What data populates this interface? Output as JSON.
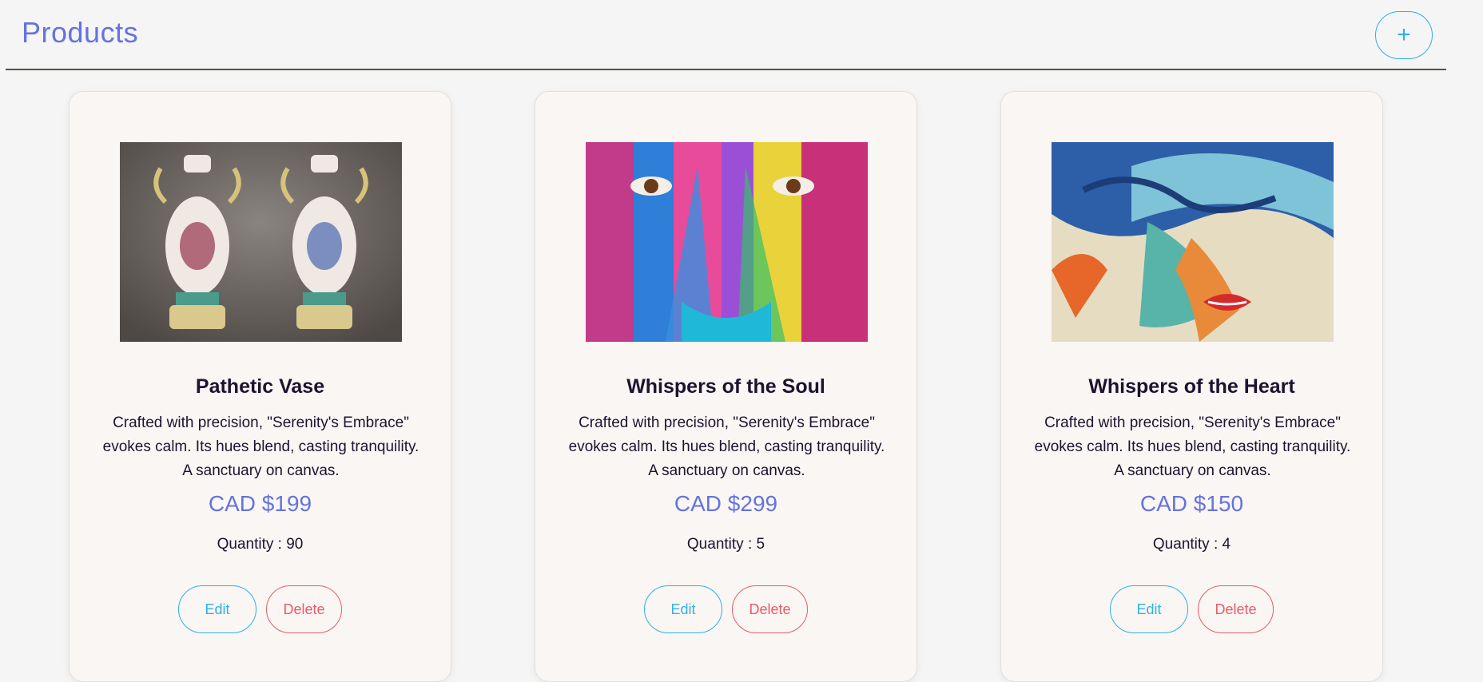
{
  "header": {
    "title": "Products",
    "add_label": "+"
  },
  "products": [
    {
      "name": "Pathetic Vase",
      "description": "Crafted with precision, \"Serenity's Embrace\" evokes calm. Its hues blend, casting tranquility. A sanctuary on canvas.",
      "price": "CAD $199",
      "quantity": "Quantity : 90",
      "edit_label": "Edit",
      "delete_label": "Delete"
    },
    {
      "name": "Whispers of the Soul",
      "description": "Crafted with precision, \"Serenity's Embrace\" evokes calm. Its hues blend, casting tranquility. A sanctuary on canvas.",
      "price": "CAD $299",
      "quantity": "Quantity : 5",
      "edit_label": "Edit",
      "delete_label": "Delete"
    },
    {
      "name": "Whispers of the Heart",
      "description": "Crafted with precision, \"Serenity's Embrace\" evokes calm. Its hues blend, casting tranquility. A sanctuary on canvas.",
      "price": "CAD $150",
      "quantity": "Quantity : 4",
      "edit_label": "Edit",
      "delete_label": "Delete"
    }
  ],
  "colors": {
    "accent": "#6473df",
    "edit": "#2fb1e6",
    "delete": "#ea5b66",
    "divider": "#4a5a38"
  }
}
